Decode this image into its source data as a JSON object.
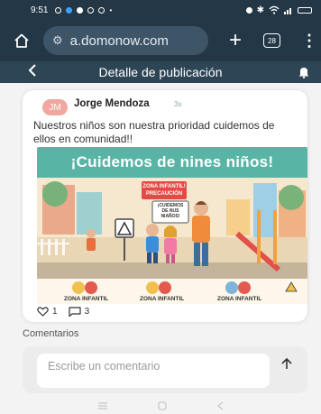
{
  "status_bar": {
    "time": "9:51"
  },
  "browser": {
    "url": "a.domonow.com",
    "tabs_count": "28"
  },
  "header": {
    "title": "Detalle de publicación"
  },
  "post": {
    "avatar_initials": "JM",
    "author": "Jorge Mendoza",
    "time_ago": "3s",
    "text": "Nuestros niños son nuestra prioridad cuidemos de ellos en comunidad!!",
    "image": {
      "banner_text": "¡Cuidemos de nines niños!",
      "sign_text": "ZONA INFANTIL! PRECAUCIÓN",
      "board_text": "¡CUIDEMOS DE NUS NIAÑOS!",
      "zone_labels": [
        "ZONA INFANTIL",
        "ZONA INFANTIL",
        "ZONA INFANTIL"
      ]
    },
    "likes": "1",
    "comments": "3"
  },
  "comments_section": {
    "label": "Comentarios",
    "placeholder": "Escribe un comentario"
  },
  "colors": {
    "status_bar": "#233746",
    "header": "#2e4556",
    "banner": "#58b5a6"
  }
}
